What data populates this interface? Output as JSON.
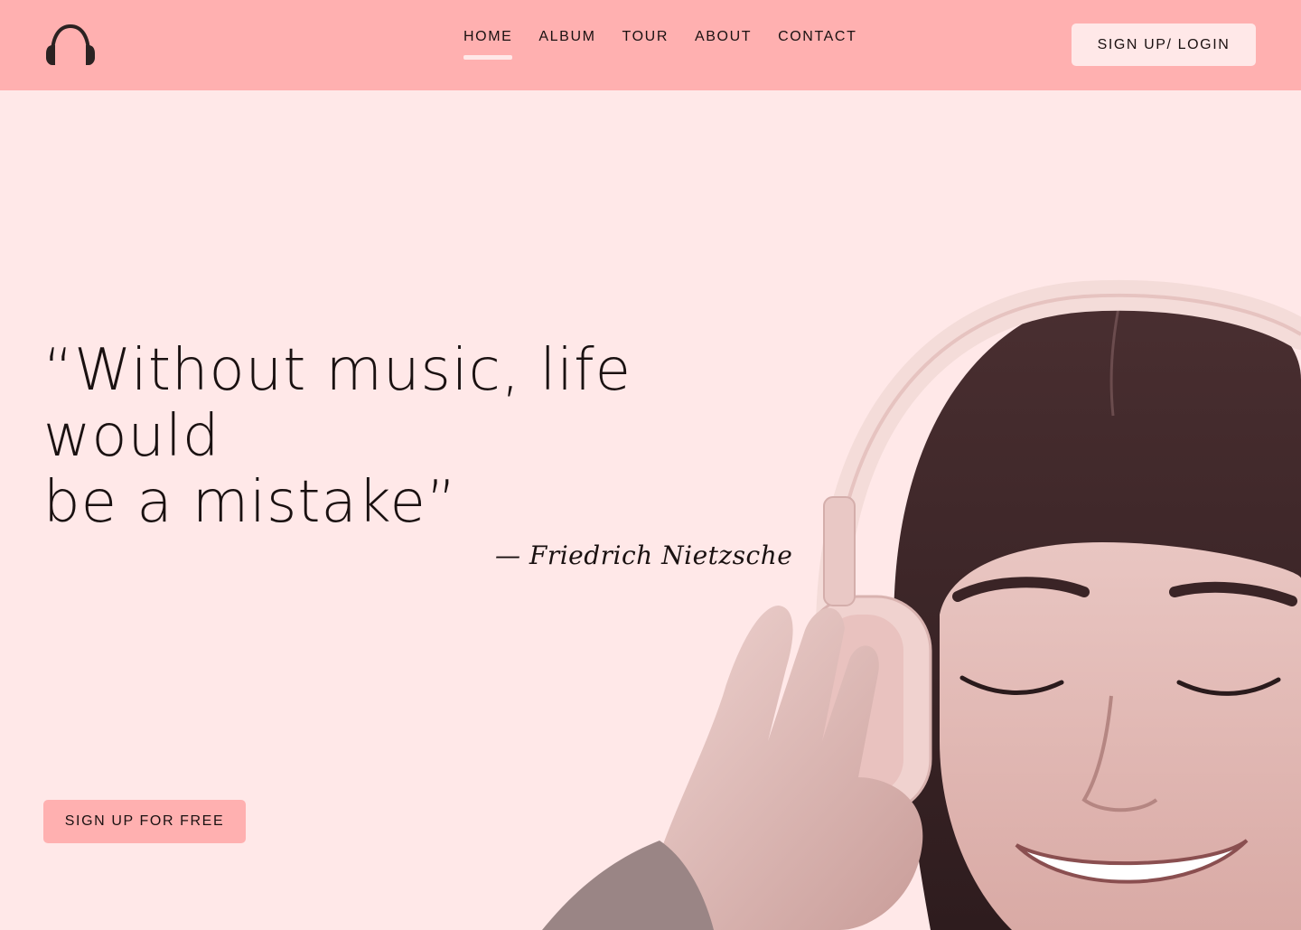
{
  "header": {
    "logo_icon": "headphones-icon",
    "nav": [
      {
        "label": "HOME",
        "active": true
      },
      {
        "label": "ALBUM",
        "active": false
      },
      {
        "label": "TOUR",
        "active": false
      },
      {
        "label": "ABOUT",
        "active": false
      },
      {
        "label": "CONTACT",
        "active": false
      }
    ],
    "login_label": "SIGN UP/ LOGIN"
  },
  "hero": {
    "quote_line1": "“Without music, life would",
    "quote_line2": "be a mistake”",
    "author": "— Friedrich Nietzsche",
    "cta_label": "SIGN UP FOR FREE"
  },
  "colors": {
    "header_bg": "#ffb0b0",
    "page_bg": "#ffe8e8",
    "text": "#1a1111",
    "accent": "#ffb0b0"
  }
}
